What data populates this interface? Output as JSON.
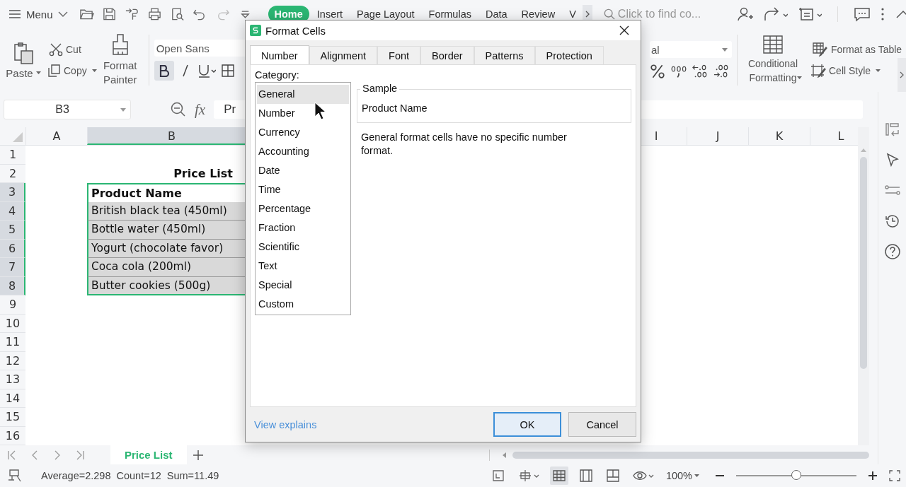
{
  "menu": {
    "label": "Menu"
  },
  "ribbon_tabs": [
    {
      "label": "Home",
      "selected": true
    },
    {
      "label": "Insert",
      "selected": false
    },
    {
      "label": "Page Layout",
      "selected": false
    },
    {
      "label": "Formulas",
      "selected": false
    },
    {
      "label": "Data",
      "selected": false
    },
    {
      "label": "Review",
      "selected": false
    },
    {
      "label": "V",
      "selected": false
    }
  ],
  "search": {
    "placeholder": "Click to find co..."
  },
  "clipboard": {
    "paste": "Paste",
    "cut": "Cut",
    "copy": "Copy",
    "format_painter": "Format Painter"
  },
  "font": {
    "name": "Open Sans",
    "bold": true
  },
  "number_format": {
    "value": "al"
  },
  "styles": {
    "conditional": "Conditional Formatting",
    "table": "Format as Table",
    "cell_style": "Cell Style"
  },
  "formula_bar": {
    "name_box": "B3",
    "fx": "fx",
    "value": "Pr"
  },
  "sheet": {
    "columns": [
      {
        "label": "A",
        "selected": false
      },
      {
        "label": "B",
        "selected": true
      },
      {
        "label": "I",
        "selected": false
      },
      {
        "label": "J",
        "selected": false
      },
      {
        "label": "K",
        "selected": false
      },
      {
        "label": "L",
        "selected": false
      }
    ],
    "rows": [
      {
        "number": "1",
        "selected": false
      },
      {
        "number": "2",
        "selected": false,
        "kind": "title",
        "b": "Price List"
      },
      {
        "number": "3",
        "selected": true,
        "kind": "header",
        "b": "Product Name"
      },
      {
        "number": "4",
        "selected": true,
        "kind": "item",
        "b": "British black tea (450ml)"
      },
      {
        "number": "5",
        "selected": true,
        "kind": "item",
        "b": "Bottle water (450ml)"
      },
      {
        "number": "6",
        "selected": true,
        "kind": "item",
        "b": "Yogurt (chocolate favor)"
      },
      {
        "number": "7",
        "selected": true,
        "kind": "item",
        "b": "Coca cola (200ml)"
      },
      {
        "number": "8",
        "selected": true,
        "kind": "item",
        "b": "Butter cookies (500g)"
      },
      {
        "number": "9",
        "selected": false
      },
      {
        "number": "10",
        "selected": false
      },
      {
        "number": "11",
        "selected": false
      },
      {
        "number": "12",
        "selected": false
      },
      {
        "number": "13",
        "selected": false
      },
      {
        "number": "14",
        "selected": false
      },
      {
        "number": "15",
        "selected": false
      },
      {
        "number": "16",
        "selected": false
      }
    ]
  },
  "sheet_tabs": [
    {
      "label": "Price List",
      "selected": true
    }
  ],
  "status_bar": {
    "stats": [
      "Average=2.298",
      "Count=12",
      "Sum=11.49"
    ],
    "zoom": "100%",
    "zoom_slider": {
      "level": 0.5
    }
  },
  "dialog": {
    "title": "Format Cells",
    "tabs": [
      {
        "label": "Number",
        "selected": true
      },
      {
        "label": "Alignment",
        "selected": false
      },
      {
        "label": "Font",
        "selected": false
      },
      {
        "label": "Border",
        "selected": false
      },
      {
        "label": "Patterns",
        "selected": false
      },
      {
        "label": "Protection",
        "selected": false
      }
    ],
    "category_label": "Category:",
    "categories": [
      {
        "label": "General",
        "selected": true
      },
      {
        "label": "Number",
        "selected": false
      },
      {
        "label": "Currency",
        "selected": false
      },
      {
        "label": "Accounting",
        "selected": false
      },
      {
        "label": "Date",
        "selected": false
      },
      {
        "label": "Time",
        "selected": false
      },
      {
        "label": "Percentage",
        "selected": false
      },
      {
        "label": "Fraction",
        "selected": false
      },
      {
        "label": "Scientific",
        "selected": false
      },
      {
        "label": "Text",
        "selected": false
      },
      {
        "label": "Special",
        "selected": false
      },
      {
        "label": "Custom",
        "selected": false
      }
    ],
    "sample_label": "Sample",
    "sample_value": "Product Name",
    "description": "General format cells have no specific number format.",
    "link": "View explains",
    "buttons": [
      {
        "label": "OK",
        "default": true
      },
      {
        "label": "Cancel",
        "default": false
      }
    ]
  }
}
